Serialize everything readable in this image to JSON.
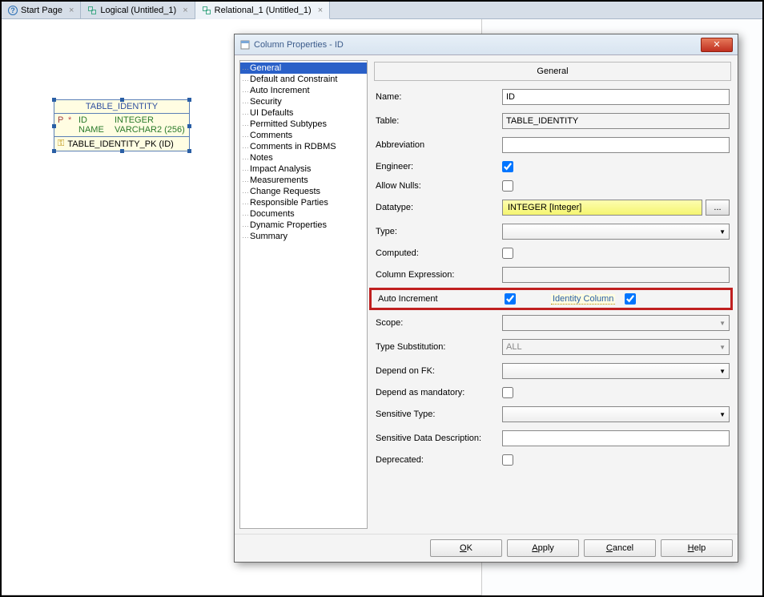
{
  "tabs": [
    {
      "label": "Start Page"
    },
    {
      "label": "Logical (Untitled_1)"
    },
    {
      "label": "Relational_1 (Untitled_1)"
    }
  ],
  "entity": {
    "title": "TABLE_IDENTITY",
    "columns": [
      {
        "flag": "P",
        "star": "*",
        "name": "ID",
        "type": "INTEGER"
      },
      {
        "flag": "",
        "star": "",
        "name": "NAME",
        "type": "VARCHAR2 (256)"
      }
    ],
    "keys": [
      {
        "name": "TABLE_IDENTITY_PK (ID)"
      }
    ]
  },
  "dialog": {
    "title": "Column Properties - ID",
    "tree": [
      "General",
      "Default and Constraint",
      "Auto Increment",
      "Security",
      "UI Defaults",
      "Permitted Subtypes",
      "Comments",
      "Comments in RDBMS",
      "Notes",
      "Impact Analysis",
      "Measurements",
      "Change Requests",
      "Responsible Parties",
      "Documents",
      "Dynamic Properties",
      "Summary"
    ],
    "tree_selected": "General",
    "section_title": "General",
    "fields": {
      "name_label": "Name:",
      "name_value": "ID",
      "table_label": "Table:",
      "table_value": "TABLE_IDENTITY",
      "abbrev_label": "Abbreviation",
      "abbrev_value": "",
      "engineer_label": "Engineer:",
      "engineer_checked": true,
      "allownulls_label": "Allow Nulls:",
      "allownulls_checked": false,
      "datatype_label": "Datatype:",
      "datatype_value": "INTEGER [Integer]",
      "ellipsis": "...",
      "type_label": "Type:",
      "type_value": "",
      "computed_label": "Computed:",
      "computed_checked": false,
      "colexpr_label": "Column Expression:",
      "colexpr_value": "",
      "autoincr_label": "Auto Increment",
      "autoincr_checked": true,
      "identity_label": "Identity Column",
      "identity_checked": true,
      "scope_label": "Scope:",
      "scope_value": "",
      "typesub_label": "Type Substitution:",
      "typesub_value": "ALL",
      "dependfk_label": "Depend on FK:",
      "dependfk_value": "",
      "dependmand_label": "Depend as mandatory:",
      "dependmand_checked": false,
      "senstype_label": "Sensitive Type:",
      "senstype_value": "",
      "sensdesc_label": "Sensitive Data Description:",
      "sensdesc_value": "",
      "deprecated_label": "Deprecated:",
      "deprecated_checked": false
    },
    "buttons": {
      "ok": "OK",
      "apply": "Apply",
      "cancel": "Cancel",
      "help": "Help"
    }
  }
}
